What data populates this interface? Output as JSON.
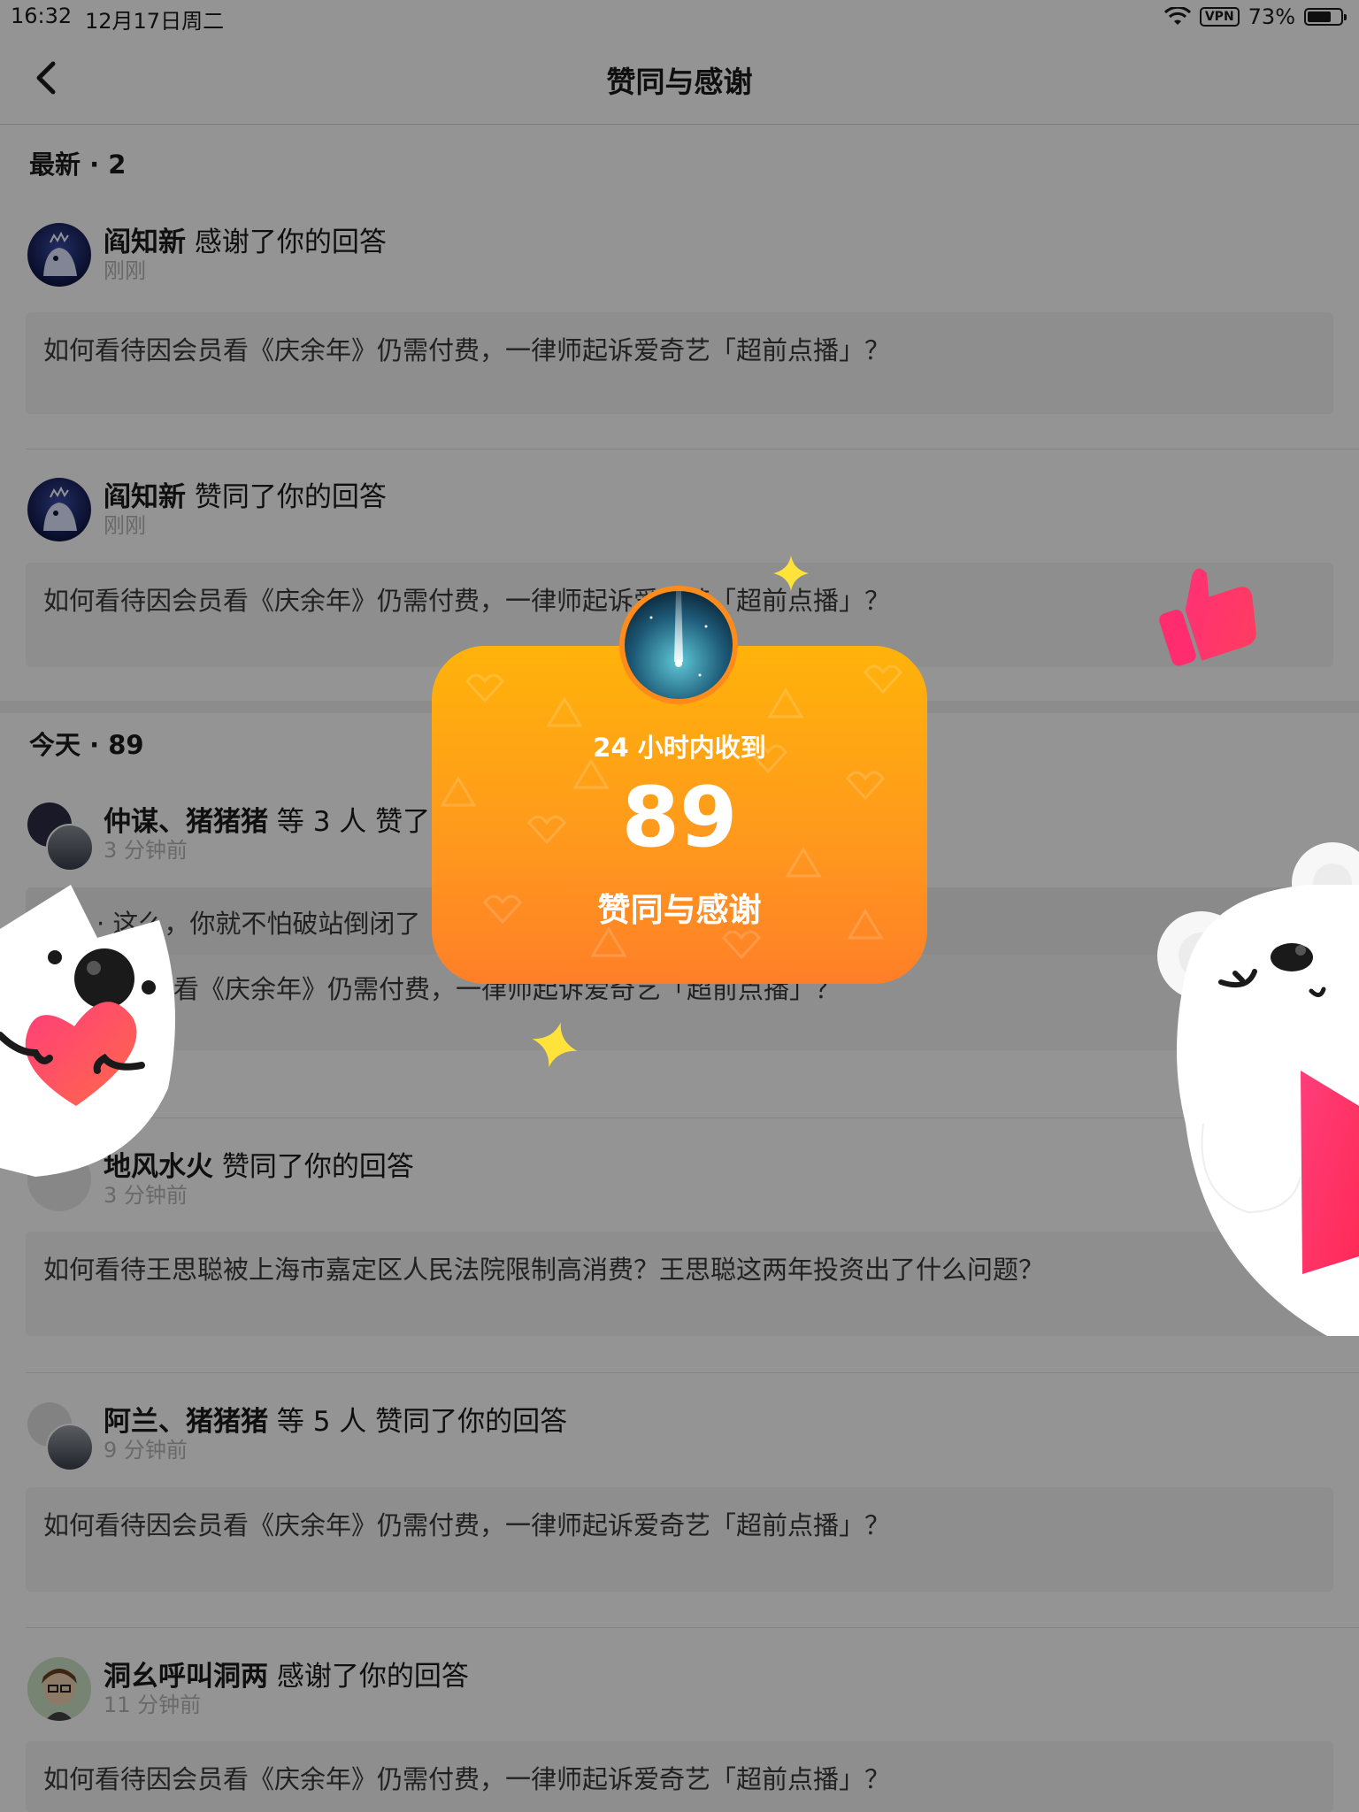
{
  "status_bar": {
    "time": "16:32",
    "date": "12月17日周二",
    "vpn": "VPN",
    "battery": "73%",
    "battery_level": 0.73
  },
  "nav": {
    "title": "赞同与感谢",
    "back_icon": "chevron-left-icon"
  },
  "sections": [
    {
      "title": "最新 · 2"
    },
    {
      "title": "今天 · 89"
    }
  ],
  "items": [
    {
      "name": "阎知新",
      "action": "感谢了你的回答",
      "time": "刚刚",
      "question": "如何看待因会员看《庆余年》仍需付费，一律师起诉爱奇艺「超前点播」？"
    },
    {
      "name": "阎知新",
      "action": "赞同了你的回答",
      "time": "刚刚",
      "question": "如何看待因会员看《庆余年》仍需付费，一律师起诉爱奇艺「超前点播」？"
    },
    {
      "name": "仲谋、猪猪猪",
      "action": "等 3 人 赞了",
      "time": "3 分钟前",
      "comment": "· 这么，你就不怕破站倒闭了",
      "question": "因会员看《庆余年》仍需付费，一律师起诉爱奇艺「超前点播」？"
    },
    {
      "name": "地风水火",
      "action": "赞同了你的回答",
      "time": "3 分钟前",
      "question": "如何看待王思聪被上海市嘉定区人民法院限制高消费？王思聪这两年投资出了什么问题？"
    },
    {
      "name": "阿兰、猪猪猪",
      "action": "等 5 人 赞同了你的回答",
      "time": "9 分钟前",
      "question": "如何看待因会员看《庆余年》仍需付费，一律师起诉爱奇艺「超前点播」？"
    },
    {
      "name": "洞幺呼叫洞两",
      "action": "感谢了你的回答",
      "time": "11 分钟前",
      "question": "如何看待因会员看《庆余年》仍需付费，一律师起诉爱奇艺「超前点播」？"
    }
  ],
  "popup": {
    "subtitle": "24 小时内收到",
    "count": "89",
    "label": "赞同与感谢"
  },
  "colors": {
    "popup_top": "#ffb30a",
    "popup_bottom": "#ff7f28",
    "thumb": "#ff2d6f",
    "star": "#ffe23a"
  }
}
